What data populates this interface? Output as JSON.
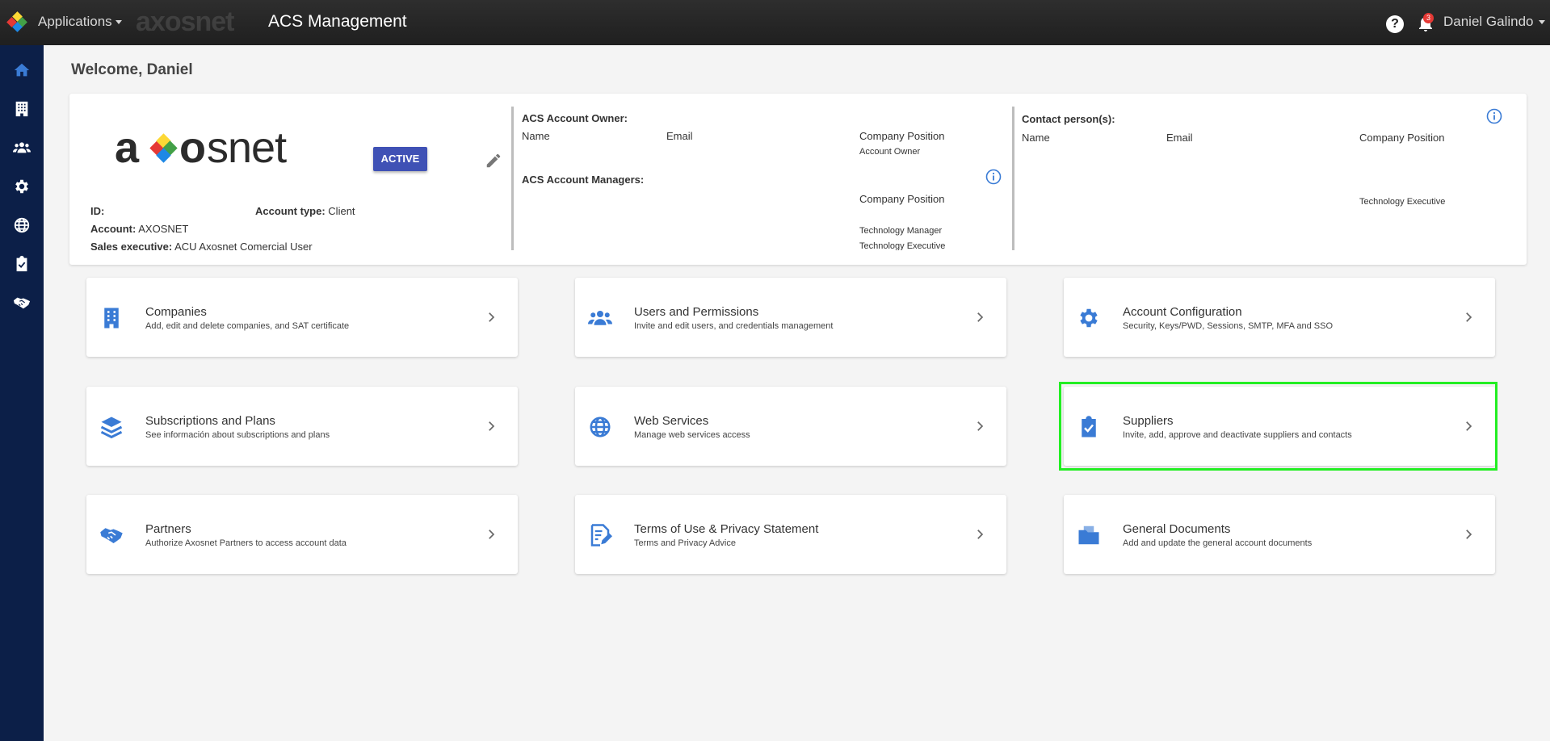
{
  "topbar": {
    "apps_label": "Applications",
    "brand_text": "axosnet",
    "app_title": "ACS Management",
    "notification_count": "3",
    "user_name": "Daniel Galindo"
  },
  "welcome": "Welcome, Daniel",
  "account": {
    "logo_text": "axosnet",
    "status": "ACTIVE",
    "id_label": "ID:",
    "account_type_label": "Account type:",
    "account_type_value": "Client",
    "account_label": "Account:",
    "account_value": "AXOSNET",
    "sales_label": "Sales executive:",
    "sales_value": "ACU Axosnet Comercial User"
  },
  "owners": {
    "owner_heading": "ACS Account Owner:",
    "col_name": "Name",
    "col_email": "Email",
    "col_position": "Company Position",
    "owner_position": "Account Owner",
    "managers_heading": "ACS Account Managers:",
    "managers_col_position": "Company Position",
    "manager_position_1": "Technology Manager",
    "manager_position_2": "Technology Executive"
  },
  "contacts": {
    "heading": "Contact person(s):",
    "col_name": "Name",
    "col_email": "Email",
    "col_position": "Company Position",
    "contact_position": "Technology Executive"
  },
  "cards": [
    {
      "title": "Companies",
      "desc": "Add, edit and delete companies, and SAT certificate",
      "icon": "building-icon"
    },
    {
      "title": "Users and Permissions",
      "desc": "Invite and edit users, and credentials management",
      "icon": "users-icon"
    },
    {
      "title": "Account Configuration",
      "desc": "Security, Keys/PWD, Sessions, SMTP, MFA and SSO",
      "icon": "gear-icon"
    },
    {
      "title": "Subscriptions and Plans",
      "desc": "See información about subscriptions and plans",
      "icon": "layers-icon"
    },
    {
      "title": "Web Services",
      "desc": "Manage web services access",
      "icon": "globe-icon"
    },
    {
      "title": "Suppliers",
      "desc": "Invite, add, approve and deactivate suppliers and contacts",
      "icon": "clipboard-check-icon"
    },
    {
      "title": "Partners",
      "desc": "Authorize Axosnet Partners to access account data",
      "icon": "handshake-icon"
    },
    {
      "title": "Terms of Use & Privacy Statement",
      "desc": "Terms and Privacy Advice",
      "icon": "document-edit-icon"
    },
    {
      "title": "General Documents",
      "desc": "Add and update the general account documents",
      "icon": "folder-icon"
    }
  ],
  "colors": {
    "accent": "#3a7bd5",
    "sidebar": "#0c1f48",
    "badge": "#3f51b5",
    "highlight": "#22ee22"
  }
}
